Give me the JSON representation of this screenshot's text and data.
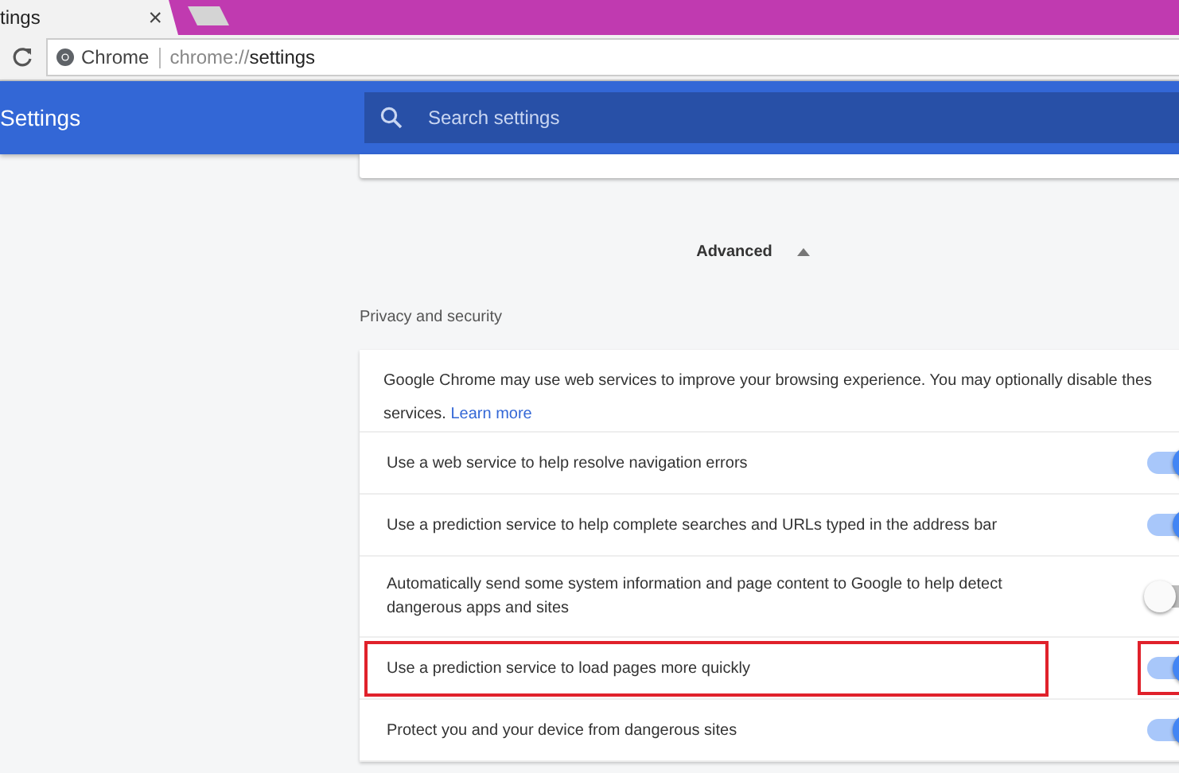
{
  "tab": {
    "title": "tings",
    "close": "×"
  },
  "address_bar": {
    "site_label": "Chrome",
    "url_prefix": "chrome://",
    "url_path": "settings"
  },
  "header": {
    "title": "Settings",
    "search": {
      "placeholder": "Search settings"
    }
  },
  "advanced": {
    "label": "Advanced",
    "expanded": true
  },
  "section": {
    "title": "Privacy and security",
    "intro": {
      "line_1": "Google Chrome may use web services to improve your browsing experience. You may optionally disable thes",
      "line_2": "services.",
      "link": "Learn more"
    },
    "rows": [
      {
        "label": "Use a web service to help resolve navigation errors",
        "on": true,
        "highlighted": false
      },
      {
        "label": "Use a prediction service to help complete searches and URLs typed in the address bar",
        "on": true,
        "highlighted": false
      },
      {
        "label": "Automatically send some system information and page content to Google to help detect dangerous apps and sites",
        "on": false,
        "highlighted": false
      },
      {
        "label": "Use a prediction service to load pages more quickly",
        "on": true,
        "highlighted": true
      },
      {
        "label": "Protect you and your device from dangerous sites",
        "on": true,
        "highlighted": false
      }
    ]
  }
}
